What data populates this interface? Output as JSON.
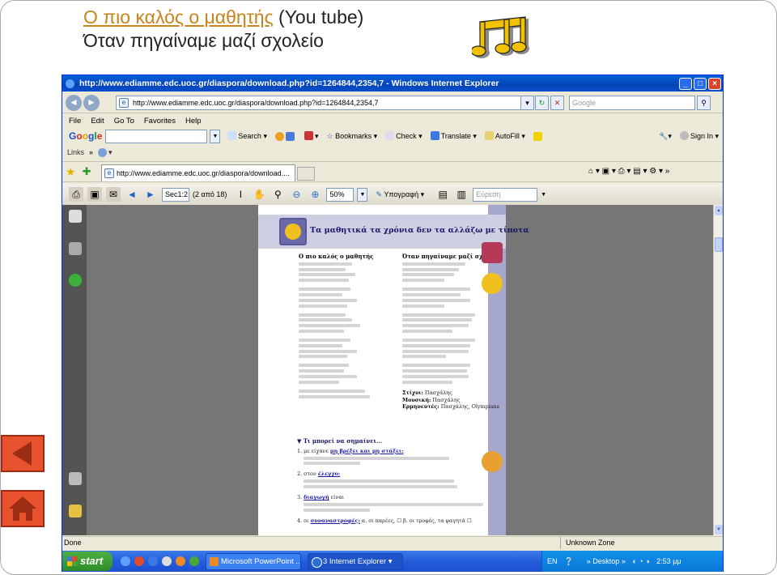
{
  "slide": {
    "song_link": "Ο πιο καλός ο μαθητής",
    "source": "(You tube)",
    "subtitle": "Όταν πηγαίναμε μαζί σχολείο"
  },
  "browser": {
    "title": "http://www.ediamme.edc.uoc.gr/diaspora/download.php?id=1264844,2354,7 - Windows Internet Explorer",
    "address": "http://www.ediamme.edc.uoc.gr/diaspora/download.php?id=1264844,2354,7",
    "search_placeholder": "Google",
    "menu": [
      "File",
      "Edit",
      "Go To",
      "Favorites",
      "Help"
    ],
    "google": {
      "logo": [
        "G",
        "o",
        "o",
        "g",
        "l",
        "e"
      ],
      "search": "Search",
      "bookmarks": "Bookmarks",
      "check": "Check",
      "translate": "Translate",
      "autofill": "AutoFill",
      "sign_in": "Sign In"
    },
    "links_label": "Links",
    "tab_title": "http://www.ediamme.edc.uoc.gr/diaspora/download....",
    "pdf": {
      "page_field": "Sec1:2",
      "page_count": "(2 από 18)",
      "zoom": "50%",
      "sign_label": "Υπογραφή",
      "find_placeholder": "Εύρεση"
    },
    "status": {
      "left": "Done",
      "zone": "Unknown Zone"
    }
  },
  "document": {
    "banner": "Τα μαθητικά τα χρόνια δεν τα αλλάζω με τίποτα",
    "song1_title": "Ο πιο καλός ο μαθητής",
    "song2_title": "Όταν πηγαίναμε μαζί σχολείο",
    "lyrics_note": "Song lyrics omitted — shown as placeholder lines",
    "credits": {
      "lyrics_label": "Στίχοι:",
      "lyrics": "Πασχάλης",
      "music_label": "Μουσική:",
      "music": "Πασχάλης",
      "performers_label": "Ερμηνευτές:",
      "performers": "Πασχάλης, Olympians"
    },
    "exercise_heading": "Τι μπορεί να σημαίνει...",
    "exercise": [
      {
        "n": "1.",
        "pre": "με είχανε",
        "term": "μη βρέξει και μη στάξει:"
      },
      {
        "n": "2.",
        "pre": "στον",
        "term": "έλεγχο:"
      },
      {
        "n": "3.",
        "pre": "",
        "term": "διαγωγή",
        "post": "είναι"
      },
      {
        "n": "4.",
        "pre": "οι",
        "term": "συναναστροφές:",
        "post": "α. οι παρέες, ☐ β. οι τροφές, τα φαγητά ☐"
      }
    ]
  },
  "taskbar": {
    "start": "start",
    "tasks": [
      "Microsoft PowerPoint ...",
      "3 Internet Explorer"
    ],
    "lang": "EN",
    "desktop": "Desktop",
    "clock": "2:53 μμ"
  },
  "colors": {
    "link": "#c8841a",
    "banner_text": "#16166a",
    "slide_nav": "#e8522c",
    "xp_blue": "#0a5fd8"
  }
}
